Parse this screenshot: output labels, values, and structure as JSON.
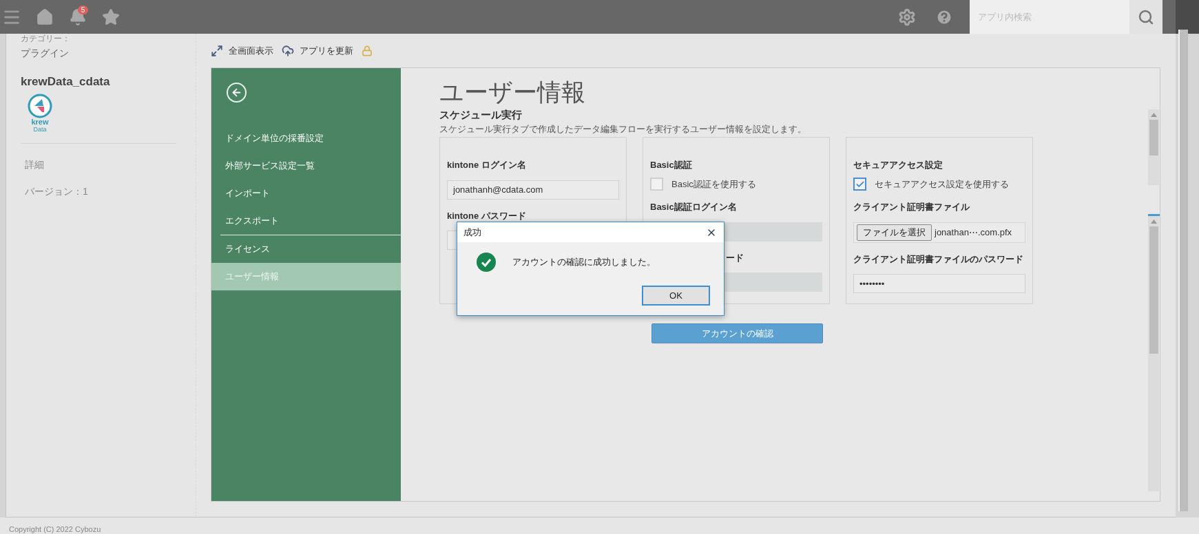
{
  "top_bar": {
    "notification_count": "5",
    "search": {
      "placeholder": "アプリ内検索"
    }
  },
  "app_info": {
    "category_label": "カテゴリー：",
    "category": "プラグイン",
    "name": "krewData_cdata",
    "logo": {
      "word": "krew",
      "sub": "Data"
    },
    "links": [
      "詳細",
      "バージョン：1"
    ]
  },
  "toolbar": [
    {
      "kind": "fullscreen",
      "label": "全画面表示"
    },
    {
      "kind": "update",
      "label": "アプリを更新"
    },
    {
      "kind": "lock"
    }
  ],
  "plugin_menu": [
    {
      "kind": "item",
      "label": "ドメイン単位の採番設定",
      "selected": false
    },
    {
      "kind": "item",
      "label": "外部サービス設定一覧",
      "selected": false
    },
    {
      "kind": "item",
      "label": "インポート",
      "selected": false
    },
    {
      "kind": "item",
      "label": "エクスポート",
      "selected": false
    },
    {
      "kind": "separator"
    },
    {
      "kind": "item",
      "label": "ライセンス",
      "selected": false
    },
    {
      "kind": "item",
      "label": "ユーザー情報",
      "selected": true
    }
  ],
  "page": {
    "title": "ユーザー情報",
    "section": "スケジュール実行",
    "description": "スケジュール実行タブで作成したデータ編集フローを実行するユーザー情報を設定します。"
  },
  "cards": [
    {
      "rows": [
        {
          "kind": "label",
          "text": "kintone ログイン名"
        },
        {
          "kind": "field",
          "value": "jonathanh@cdata.com",
          "disabled": false
        },
        {
          "kind": "label",
          "text": "kintone パスワード"
        },
        {
          "kind": "field",
          "disabled": false
        }
      ]
    },
    {
      "rows": [
        {
          "kind": "label",
          "text": "Basic認証"
        },
        {
          "kind": "checkbox",
          "label": "Basic認証を使用する",
          "checked": false
        },
        {
          "kind": "label",
          "text": "Basic認証ログイン名"
        },
        {
          "kind": "field",
          "disabled": true
        },
        {
          "kind": "label_tail",
          "text": "ード"
        },
        {
          "kind": "field",
          "disabled": true
        }
      ]
    },
    {
      "rows": [
        {
          "kind": "label",
          "text": "セキュアアクセス設定"
        },
        {
          "kind": "checkbox",
          "label": "セキュアアクセス設定を使用する",
          "checked": true
        },
        {
          "kind": "label",
          "text": "クライアント証明書ファイル"
        },
        {
          "kind": "file",
          "button": "ファイルを選択",
          "file_name": "jonathan⋯.com.pfx"
        },
        {
          "kind": "label",
          "text": "クライアント証明書ファイルのパスワード"
        },
        {
          "kind": "field",
          "value": "••••••••",
          "disabled": false
        }
      ]
    }
  ],
  "confirm_button": "アカウントの確認",
  "dialog": {
    "title": "成功",
    "message": "アカウントの確認に成功しました。",
    "ok": "OK"
  },
  "footer": "Copyright (C) 2022 Cybozu"
}
